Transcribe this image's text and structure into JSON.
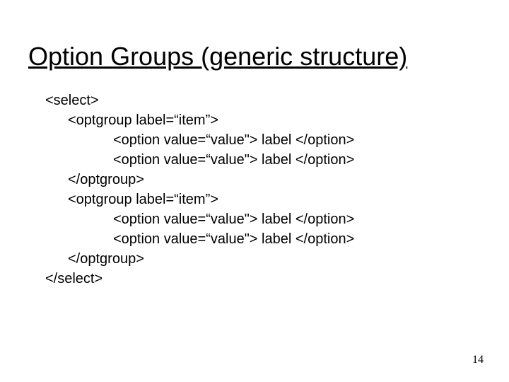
{
  "title": "Option Groups (generic structure)",
  "code": {
    "l1": "<select>",
    "l2": "<optgroup label=“item”>",
    "l3": "<option value=“value\"> label </option>",
    "l4": "<option value=“value\"> label </option>",
    "l5": "</optgroup>",
    "l6": "<optgroup label=“item”>",
    "l7": "<option value=“value\"> label </option>",
    "l8": "<option value=“value\"> label </option>",
    "l9": "</optgroup>",
    "l10": "</select>"
  },
  "pageNumber": "14"
}
